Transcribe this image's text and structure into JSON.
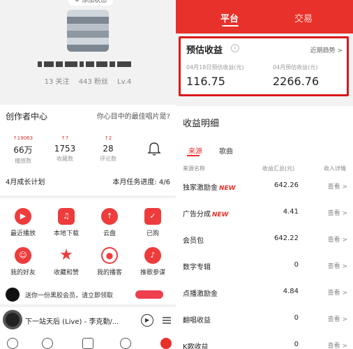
{
  "profile": {
    "add_status": "+ 添加状态",
    "follow": "13 关注",
    "fans": "443 粉丝",
    "level": "Lv.4"
  },
  "creator": {
    "title": "创作者中心",
    "question": "你心目中的最佳唱片是?",
    "metrics": [
      {
        "delta": "↑19063",
        "num": "66万",
        "label": "播放数"
      },
      {
        "delta": "↑7",
        "num": "1753",
        "label": "收藏数"
      },
      {
        "delta": "↑2",
        "num": "28",
        "label": "评论数"
      }
    ],
    "plan_title": "4月成长计划",
    "plan_progress": "本月任务进度: 4/6"
  },
  "apps": [
    {
      "label": "最近播放",
      "icon": "play-icon"
    },
    {
      "label": "本地下载",
      "icon": "music-note-icon"
    },
    {
      "label": "云盘",
      "icon": "cloud-upload-icon"
    },
    {
      "label": "已购",
      "icon": "shopping-bag-icon"
    },
    {
      "label": "我的好友",
      "icon": "friends-icon"
    },
    {
      "label": "收藏和赞",
      "icon": "star-icon"
    },
    {
      "label": "我的播客",
      "icon": "podcast-icon"
    },
    {
      "label": "推歌参谋",
      "icon": "advisor-icon"
    }
  ],
  "promo": {
    "text": "送你一份黑胶会员，请立即领取"
  },
  "player": {
    "song": "下一站天后 (Live) - 李克勤/..."
  },
  "right": {
    "tab_active": "平台",
    "tab_inactive": "交易",
    "earnings": {
      "title": "预估收益",
      "trend": "近期趋势 >",
      "day_label": "04月18日预估收益(元)",
      "day_value": "116.75",
      "month_label": "04月预估收益(元)",
      "month_value": "2266.76"
    },
    "detail": {
      "title": "收益明细",
      "tab_source": "来源",
      "tab_song": "歌曲",
      "col_name": "来源名称",
      "col_total": "收益汇总(元)",
      "col_detail": "收入详情",
      "rows": [
        {
          "name": "独家激励金",
          "new": "NEW",
          "amount": "642.26",
          "view": "查看 >"
        },
        {
          "name": "广告分成",
          "new": "NEW",
          "amount": "4.41",
          "view": "查看 >"
        },
        {
          "name": "会员包",
          "new": "",
          "amount": "642.22",
          "view": "查看 >"
        },
        {
          "name": "数字专辑",
          "new": "",
          "amount": "0",
          "view": "查看 >"
        },
        {
          "name": "点播激励金",
          "new": "",
          "amount": "4.84",
          "view": "查看 >"
        },
        {
          "name": "翻唱收益",
          "new": "",
          "amount": "0",
          "view": "查看 >"
        },
        {
          "name": "K歌收益",
          "new": "",
          "amount": "0",
          "view": "查看 >"
        }
      ]
    }
  },
  "colors": {
    "accent": "#e8312a",
    "highlight_border": "#d9191c"
  }
}
